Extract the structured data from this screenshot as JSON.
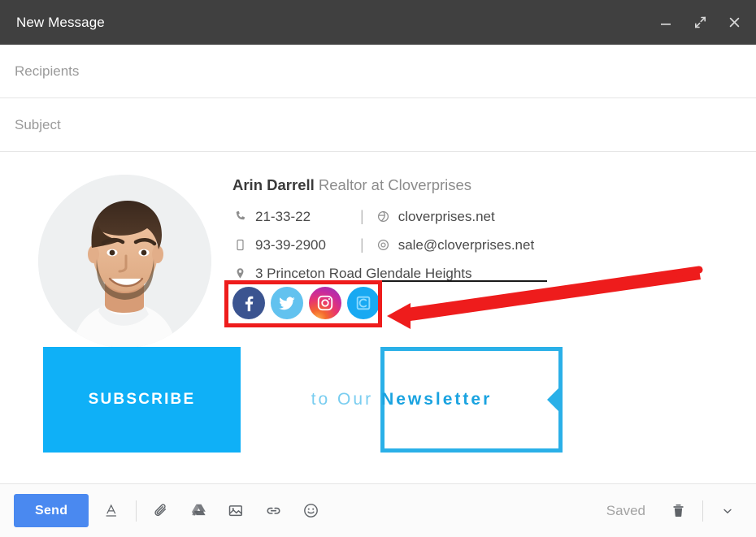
{
  "window": {
    "title": "New Message",
    "controls": [
      {
        "name": "minimize-button",
        "icon": "minimize-icon"
      },
      {
        "name": "expand-button",
        "icon": "expand-icon"
      },
      {
        "name": "close-button",
        "icon": "close-icon"
      }
    ]
  },
  "fields": {
    "recipients": {
      "value": "",
      "placeholder": "Recipients"
    },
    "subject": {
      "value": "",
      "placeholder": "Subject"
    }
  },
  "signature": {
    "avatar_alt": "portrait-photo",
    "name": "Arin Darrell",
    "role": " Realtor at Cloverprises",
    "phone": "21-33-22",
    "website": "cloverprises.net",
    "mobile": "93-39-2900",
    "email": "sale@cloverprises.net",
    "address": "3 Princeton Road Glendale Heights",
    "separator": "|",
    "socials": [
      {
        "name": "facebook-icon",
        "label": "Facebook",
        "color": "#3b5490"
      },
      {
        "name": "twitter-icon",
        "label": "Twitter",
        "color": "#62c2ef"
      },
      {
        "name": "instagram-icon",
        "label": "Instagram",
        "color": "#c32aa3"
      },
      {
        "name": "selected-social-icon",
        "label": "Selected social",
        "color": "#18a9f2"
      }
    ]
  },
  "banner": {
    "subscribe_label": "SUBSCRIBE",
    "text_light": "to Our",
    "text_bold": "Newsletter",
    "accent_color": "#0fb0f7",
    "outline_color": "#2ab0e8"
  },
  "annotation": {
    "highlight_color": "#ee1c1c",
    "target": "social-icons-row"
  },
  "footer": {
    "send_label": "Send",
    "tools": [
      {
        "name": "format-text-icon",
        "label": "Formatting options"
      },
      {
        "name": "attach-file-icon",
        "label": "Attach files"
      },
      {
        "name": "google-drive-icon",
        "label": "Insert files using Drive"
      },
      {
        "name": "insert-photo-icon",
        "label": "Insert photo"
      },
      {
        "name": "insert-link-icon",
        "label": "Insert link"
      },
      {
        "name": "insert-emoji-icon",
        "label": "Insert emoji"
      }
    ],
    "saved_label": "Saved",
    "trash_label": "Discard draft",
    "more_label": "More options"
  }
}
